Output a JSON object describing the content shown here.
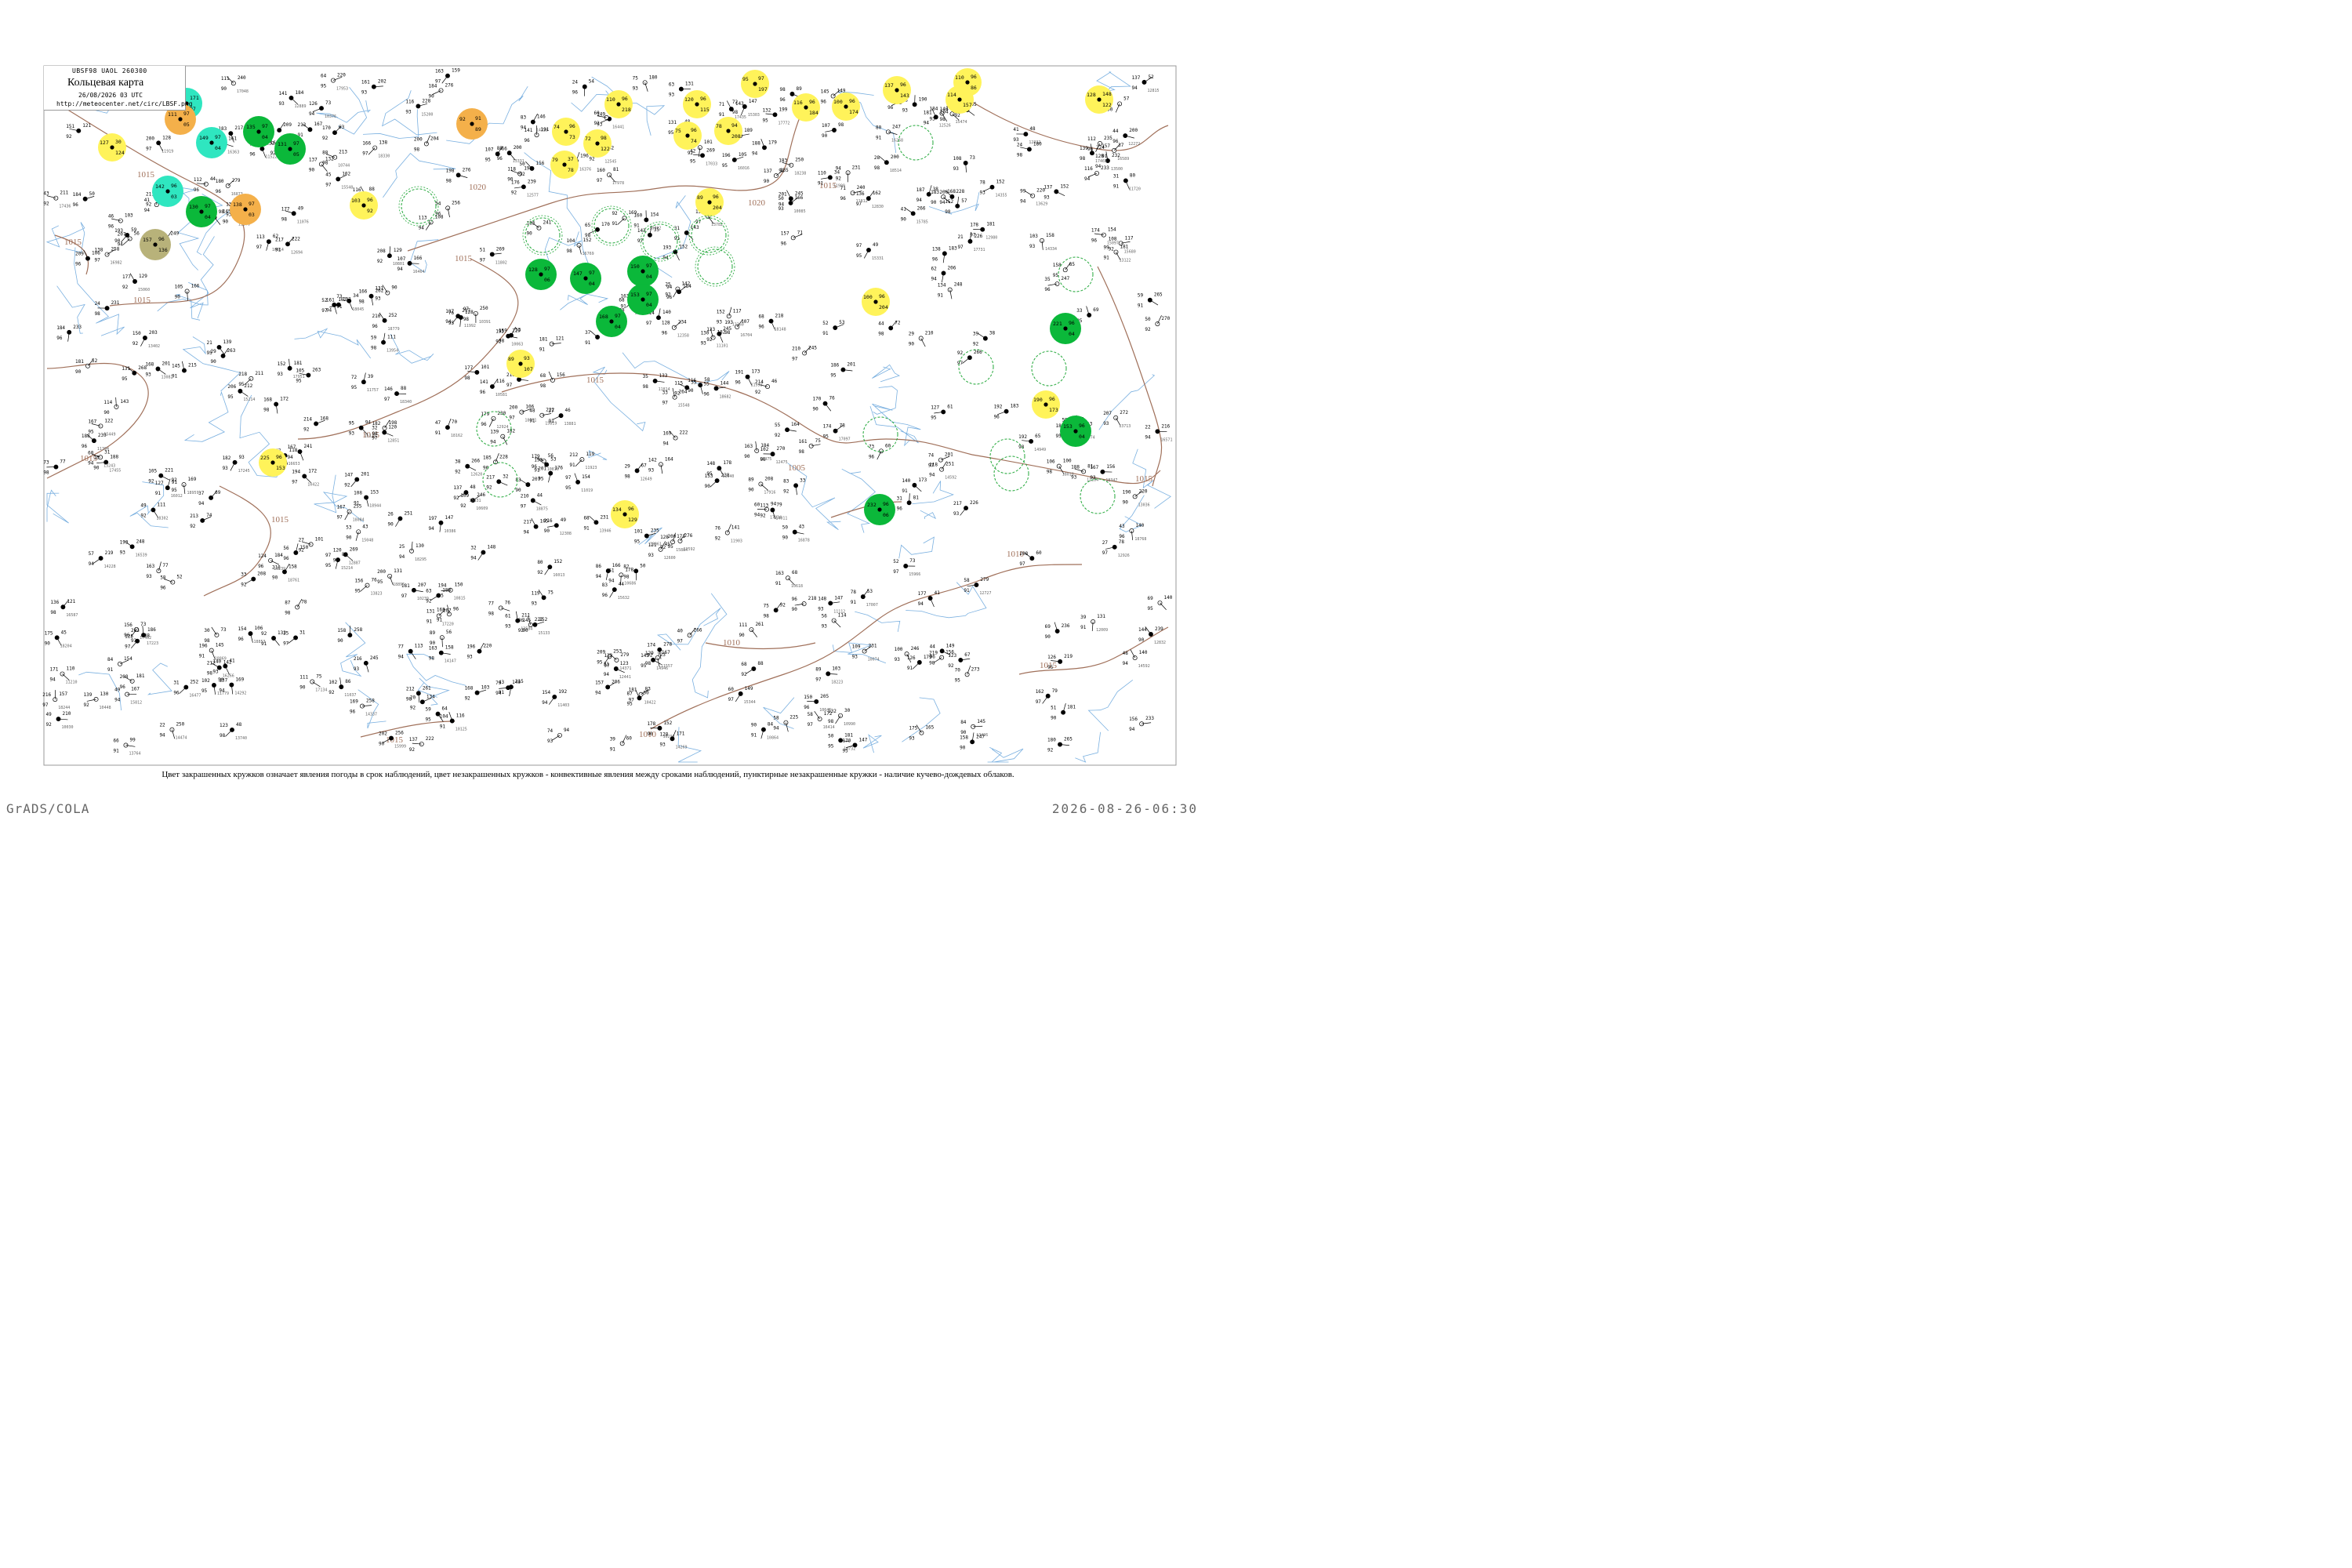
{
  "header": {
    "code_line": "UBSF98  UAOL  260300",
    "title": "Кольцевая карта",
    "date": "26/08/2026 03 UTC",
    "url": "http://meteocenter.net/circ/LBSF.png"
  },
  "caption": "Цвет закрашенных кружков означает явления погоды в срок наблюдений, цвет незакрашенных кружков - конвективные явления между сроками наблюдений, пунктирные незакрашенные кружки - наличие кучево-дождевых облаков.",
  "footer": {
    "left": "GrADS/COLA",
    "right": "2026-08-26-06:30"
  },
  "colors": {
    "rain": "#0bb83a",
    "drizzle": "#2fe6c0",
    "fog": "#fff35a",
    "haze": "#f4b04a",
    "shower_outline": "#23a83a",
    "isobar": "#a0705a",
    "river": "#7ab0e0"
  },
  "isobar_labels": [
    "1015",
    "1015",
    "1015",
    "1015",
    "1015",
    "1015",
    "1015",
    "1020",
    "1020",
    "1015",
    "1015",
    "1010",
    "1010",
    "1010",
    "1015",
    "1015",
    "1015",
    "1005"
  ],
  "stations": [
    {
      "id": "s1",
      "color": "drizzle",
      "t": "76",
      "p": "171",
      "d": "07"
    },
    {
      "id": "s2",
      "color": "haze",
      "t": "111",
      "p": "97",
      "d": "05"
    },
    {
      "id": "s3",
      "color": "rain",
      "t": "135",
      "p": "97",
      "d": "04"
    },
    {
      "id": "s4",
      "color": "rain",
      "t": "131",
      "p": "97",
      "d": "05"
    },
    {
      "id": "s5",
      "color": "drizzle",
      "t": "149",
      "p": "97",
      "d": "04"
    },
    {
      "id": "s6",
      "color": "fog",
      "t": "127",
      "p": "30",
      "d": "124"
    },
    {
      "id": "s7",
      "color": "drizzle",
      "t": "142",
      "p": "96",
      "d": "03"
    },
    {
      "id": "s8",
      "color": "rain",
      "t": "130",
      "p": "97",
      "d": "04"
    },
    {
      "id": "s9",
      "color": "haze",
      "t": "138",
      "p": "97",
      "d": "03"
    },
    {
      "id": "s10",
      "color": "olive",
      "t": "157",
      "p": "96",
      "d": "136"
    },
    {
      "id": "s11",
      "color": "fog",
      "t": "103",
      "p": "96",
      "d": "92"
    },
    {
      "id": "s12",
      "color": "haze",
      "t": "92",
      "p": "91",
      "d": "89"
    },
    {
      "id": "s13",
      "color": "fog",
      "t": "72",
      "p": "98",
      "d": "122"
    },
    {
      "id": "s14",
      "color": "fog",
      "t": "74",
      "p": "96",
      "d": "73"
    },
    {
      "id": "s15",
      "color": "fog",
      "t": "79",
      "p": "37",
      "d": "78"
    },
    {
      "id": "s16",
      "color": "fog",
      "t": "110",
      "p": "96",
      "d": "218"
    },
    {
      "id": "s17",
      "color": "fog",
      "t": "120",
      "p": "96",
      "d": "115"
    },
    {
      "id": "s18",
      "color": "fog",
      "t": "75",
      "p": "96",
      "d": "74"
    },
    {
      "id": "s19",
      "color": "fog",
      "t": "78",
      "p": "94",
      "d": "208"
    },
    {
      "id": "s20",
      "color": "fog",
      "t": "95",
      "p": "97",
      "d": "197"
    },
    {
      "id": "s21",
      "color": "fog",
      "t": "116",
      "p": "96",
      "d": "184"
    },
    {
      "id": "s22",
      "color": "fog",
      "t": "100",
      "p": "96",
      "d": "174"
    },
    {
      "id": "s23",
      "color": "fog",
      "t": "137",
      "p": "96",
      "d": "143"
    },
    {
      "id": "s24",
      "color": "fog",
      "t": "114",
      "p": "96",
      "d": "157"
    },
    {
      "id": "s25",
      "color": "fog",
      "t": "128",
      "p": "148",
      "d": "122"
    },
    {
      "id": "s26",
      "color": "fog",
      "t": "89",
      "p": "96",
      "d": "204"
    },
    {
      "id": "s27",
      "color": "fog",
      "t": "100",
      "p": "96",
      "d": "204"
    },
    {
      "id": "s28",
      "color": "fog",
      "t": "89",
      "p": "93",
      "d": "107"
    },
    {
      "id": "s29",
      "color": "fog",
      "t": "225",
      "p": "96",
      "d": "153"
    },
    {
      "id": "s30",
      "color": "fog",
      "t": "134",
      "p": "96",
      "d": "129"
    },
    {
      "id": "s31",
      "color": "rain",
      "t": "128",
      "p": "97",
      "d": "06"
    },
    {
      "id": "s32",
      "color": "rain",
      "t": "147",
      "p": "97",
      "d": "04"
    },
    {
      "id": "s33",
      "color": "rain",
      "t": "150",
      "p": "97",
      "d": "04"
    },
    {
      "id": "s34",
      "color": "rain",
      "t": "153",
      "p": "97",
      "d": "04"
    },
    {
      "id": "s35",
      "color": "rain",
      "t": "168",
      "p": "97",
      "d": "04"
    },
    {
      "id": "s36",
      "color": "rain",
      "t": "221",
      "p": "96",
      "d": "04"
    },
    {
      "id": "s37",
      "color": "rain",
      "t": "153",
      "p": "96",
      "d": "04"
    },
    {
      "id": "s38",
      "color": "rain",
      "t": "232",
      "p": "96",
      "d": "06"
    },
    {
      "id": "s39",
      "color": "fog",
      "t": "190",
      "p": "96",
      "d": "173"
    },
    {
      "id": "s40",
      "color": "fog",
      "t": "110",
      "p": "96",
      "d": "86"
    }
  ]
}
